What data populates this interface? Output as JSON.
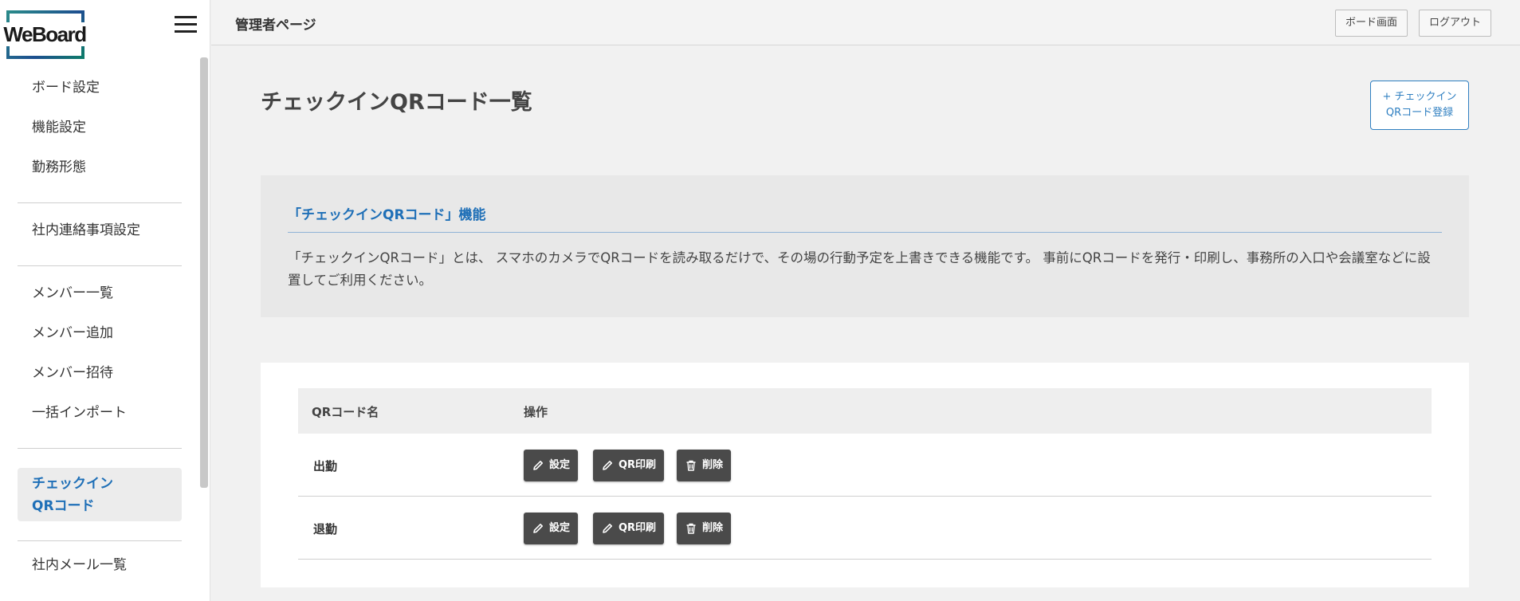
{
  "brand": {
    "logo_text": "WeBoard"
  },
  "header": {
    "title": "管理者ページ",
    "board_button": "ボード画面",
    "logout_button": "ログアウト"
  },
  "sidebar": {
    "items": [
      {
        "label": "ボード設定"
      },
      {
        "label": "機能設定"
      },
      {
        "label": "勤務形態"
      },
      {
        "label": "社内連絡事項設定"
      },
      {
        "label": "メンバー一覧"
      },
      {
        "label": "メンバー追加"
      },
      {
        "label": "メンバー招待"
      },
      {
        "label": "一括インポート"
      },
      {
        "label": "チェックイン\nQRコード",
        "line1": "チェックイン",
        "line2": "QRコード",
        "active": true
      },
      {
        "label": "社内メール一覧"
      }
    ]
  },
  "main": {
    "page_title": "チェックインQRコード一覧",
    "add_button_line1": "+ チェックイン",
    "add_button_line2": "QRコード登録",
    "info": {
      "heading": "「チェックインQRコード」機能",
      "description": "「チェックインQRコード」とは、 スマホのカメラでQRコードを読み取るだけで、その場の行動予定を上書きできる機能です。 事前にQRコードを発行・印刷し、事務所の入口や会議室などに設置してご利用ください。"
    },
    "table": {
      "columns": [
        "QRコード名",
        "操作"
      ],
      "rows": [
        {
          "name": "出勤",
          "actions": [
            "設定",
            "QR印刷",
            "削除"
          ]
        },
        {
          "name": "退勤",
          "actions": [
            "設定",
            "QR印刷",
            "削除"
          ]
        }
      ]
    }
  },
  "colors": {
    "accent": "#1e6fb7",
    "action_button": "#4a4a4a",
    "page_background": "#f1f1f1"
  },
  "icons": [
    "hamburger-icon",
    "pencil-icon",
    "trash-icon"
  ]
}
